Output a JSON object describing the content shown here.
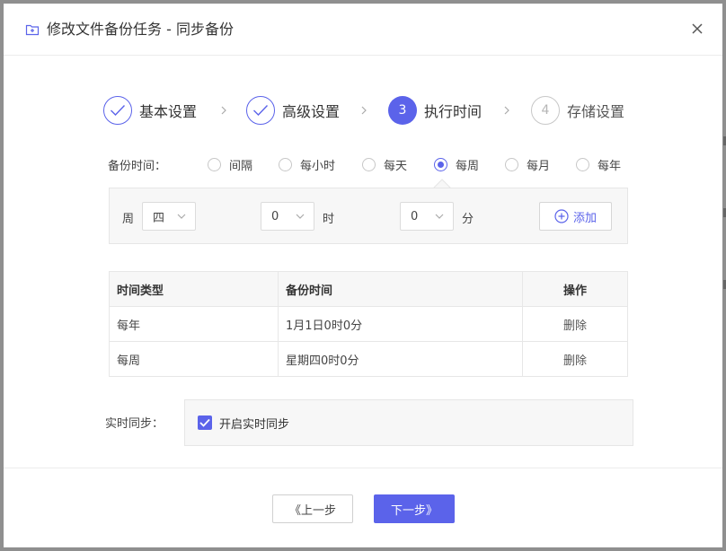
{
  "dialog": {
    "title": "修改文件备份任务 - 同步备份"
  },
  "steps": [
    {
      "marker": "",
      "label": "基本设置",
      "state": "done"
    },
    {
      "marker": "",
      "label": "高级设置",
      "state": "done"
    },
    {
      "marker": "3",
      "label": "执行时间",
      "state": "active"
    },
    {
      "marker": "4",
      "label": "存储设置",
      "state": "todo"
    }
  ],
  "backup_time": {
    "label": "备份时间：",
    "options": [
      "间隔",
      "每小时",
      "每天",
      "每周",
      "每月",
      "每年"
    ],
    "selected": "每周"
  },
  "weekly": {
    "week_label": "周",
    "week_value": "四",
    "hour_value": "0",
    "hour_unit": "时",
    "minute_value": "0",
    "minute_unit": "分",
    "add_label": "添加"
  },
  "schedule_table": {
    "headers": [
      "时间类型",
      "备份时间",
      "操作"
    ],
    "rows": [
      {
        "type": "每年",
        "time": "1月1日0时0分",
        "action": "删除"
      },
      {
        "type": "每周",
        "time": "星期四0时0分",
        "action": "删除"
      }
    ]
  },
  "realtime": {
    "label": "实时同步：",
    "checkbox_label": "开启实时同步",
    "checked": true
  },
  "footer": {
    "prev_label": "《上一步",
    "next_label": "下一步》"
  },
  "colors": {
    "accent": "#5b63ea",
    "overlay": "#8f8f8f"
  }
}
